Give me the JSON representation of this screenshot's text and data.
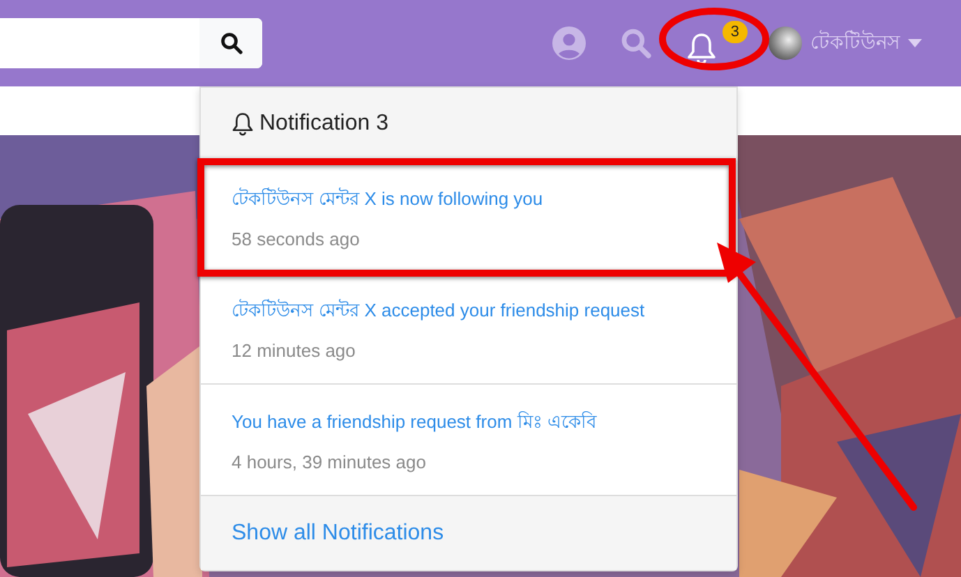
{
  "header": {
    "notification_badge": "3",
    "user_name": "টেকটিউনস"
  },
  "notifications": {
    "title": "Notification 3",
    "items": [
      {
        "text": "টেকটিউনস মেন্টর X is now following you",
        "time": "58 seconds ago"
      },
      {
        "text": "টেকটিউনস মেন্টর X accepted your friendship request",
        "time": "12 minutes ago"
      },
      {
        "text": "You have a friendship request from মিঃ একেবি",
        "time": "4 hours, 39 minutes ago"
      }
    ],
    "footer_link": "Show all Notifications"
  }
}
